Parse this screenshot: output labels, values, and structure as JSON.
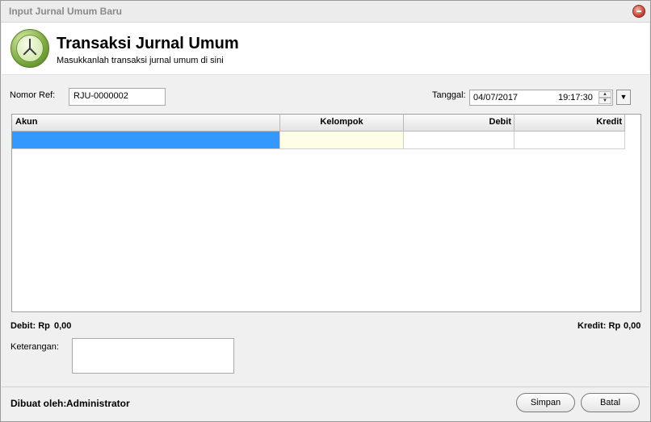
{
  "window": {
    "title": "Input Jurnal Umum Baru"
  },
  "header": {
    "title": "Transaksi Jurnal Umum",
    "subtitle": "Masukkanlah transaksi jurnal umum di sini"
  },
  "form": {
    "nomor_ref_label": "Nomor Ref:",
    "nomor_ref_value": "RJU-0000002",
    "tanggal_label": "Tanggal:",
    "tanggal_date": "04/07/2017",
    "tanggal_time": "19:17:30"
  },
  "grid": {
    "columns": [
      "Akun",
      "Kelompok",
      "Debit",
      "Kredit"
    ],
    "rows": [
      [
        "",
        "",
        "",
        ""
      ]
    ],
    "selected_color": "#3399ff",
    "kelompok_cell_color": "#fefee6"
  },
  "totals": {
    "debit_label": "Debit: Rp",
    "debit_value": "0,00",
    "kredit_label": "Kredit: Rp",
    "kredit_value": "0,00"
  },
  "keterangan": {
    "label": "Keterangan:",
    "value": ""
  },
  "footer": {
    "created_by_label": "Dibuat oleh:",
    "created_by_value": "Administrator",
    "save_label": "Simpan",
    "cancel_label": "Batal"
  },
  "icons": {
    "header_icon": "clock-icon",
    "close": "close-icon",
    "dropdown": "chevron-down-icon"
  }
}
